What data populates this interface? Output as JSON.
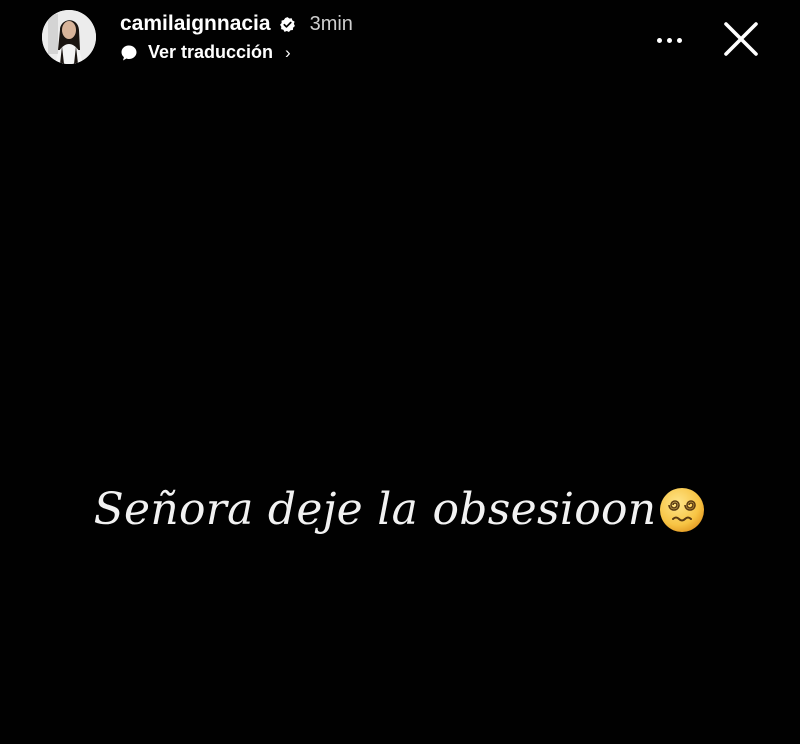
{
  "story": {
    "header": {
      "username": "camilaignnacia",
      "verified_icon": "verified-badge-icon",
      "time": "3min",
      "translate": {
        "icon": "speech-bubble-icon",
        "label": "Ver traducción",
        "chevron": "›"
      },
      "more_icon": "more-options-icon",
      "close_icon": "close-icon"
    },
    "caption": {
      "text": "Señora deje la obsesioon",
      "emoji": "face-with-spiral-eyes-emoji"
    }
  }
}
